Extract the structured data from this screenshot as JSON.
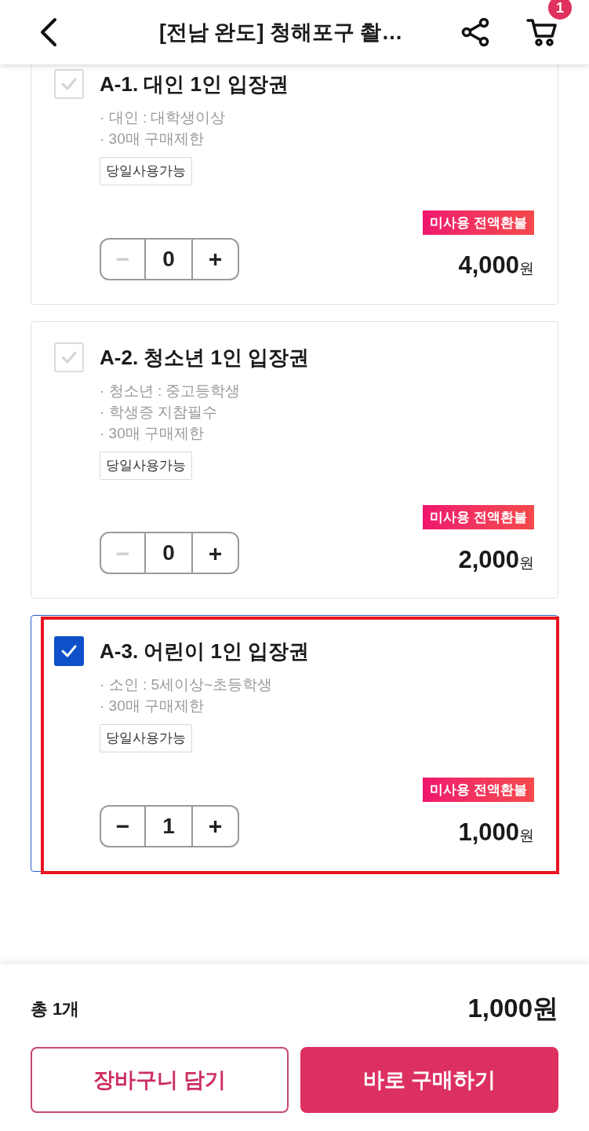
{
  "header": {
    "title": "[전남 완도] 청해포구 촬…",
    "cart_count": "1"
  },
  "options": [
    {
      "title": "A-1. 대인 1인 입장권",
      "checked": false,
      "selected": false,
      "highlighted": false,
      "details": [
        "· 대인 : 대학생이상",
        "· 30매 구매제한"
      ],
      "tag": "당일사용가능",
      "badge": "미사용 전액환불",
      "decrease": "−",
      "quantity": "0",
      "increase": "+",
      "decrease_disabled": true,
      "price": "4,000",
      "unit": "원"
    },
    {
      "title": "A-2. 청소년 1인 입장권",
      "checked": false,
      "selected": false,
      "highlighted": false,
      "details": [
        "· 청소년 : 중고등학생",
        "· 학생증 지참필수",
        "· 30매 구매제한"
      ],
      "tag": "당일사용가능",
      "badge": "미사용 전액환불",
      "decrease": "−",
      "quantity": "0",
      "increase": "+",
      "decrease_disabled": true,
      "price": "2,000",
      "unit": "원"
    },
    {
      "title": "A-3. 어린이 1인 입장권",
      "checked": true,
      "selected": true,
      "highlighted": true,
      "details": [
        "· 소인 : 5세이상~초등학생",
        "· 30매 구매제한"
      ],
      "tag": "당일사용가능",
      "badge": "미사용 전액환불",
      "decrease": "−",
      "quantity": "1",
      "increase": "+",
      "decrease_disabled": false,
      "price": "1,000",
      "unit": "원"
    }
  ],
  "footer": {
    "count": "총 1개",
    "total": "1,000원",
    "buttons": [
      {
        "kind": "outline",
        "label": "장바구니 담기"
      },
      {
        "kind": "filled",
        "label": "바로 구매하기"
      }
    ]
  }
}
